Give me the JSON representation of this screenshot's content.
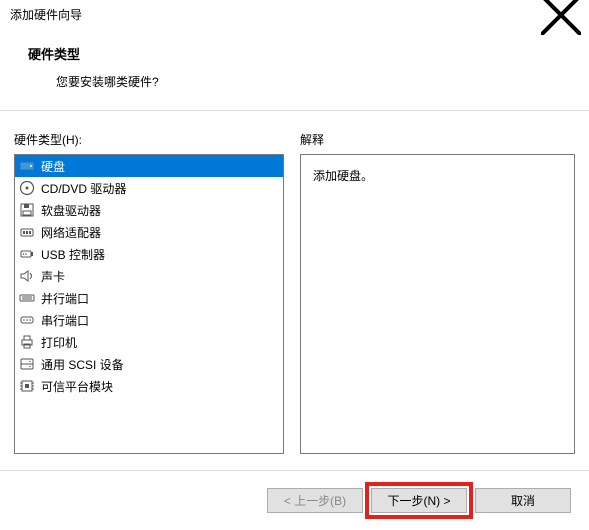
{
  "window": {
    "title": "添加硬件向导"
  },
  "header": {
    "title": "硬件类型",
    "subtitle": "您要安装哪类硬件?"
  },
  "labels": {
    "hardware_types": "硬件类型(H):",
    "explanation": "解释"
  },
  "hardware_list": {
    "items": [
      {
        "icon": "hdd-icon",
        "label": "硬盘",
        "selected": true
      },
      {
        "icon": "cd-icon",
        "label": "CD/DVD 驱动器",
        "selected": false
      },
      {
        "icon": "floppy-icon",
        "label": "软盘驱动器",
        "selected": false
      },
      {
        "icon": "network-icon",
        "label": "网络适配器",
        "selected": false
      },
      {
        "icon": "usb-icon",
        "label": "USB 控制器",
        "selected": false
      },
      {
        "icon": "sound-icon",
        "label": "声卡",
        "selected": false
      },
      {
        "icon": "parallel-icon",
        "label": "并行端口",
        "selected": false
      },
      {
        "icon": "serial-icon",
        "label": "串行端口",
        "selected": false
      },
      {
        "icon": "printer-icon",
        "label": "打印机",
        "selected": false
      },
      {
        "icon": "scsi-icon",
        "label": "通用 SCSI 设备",
        "selected": false
      },
      {
        "icon": "tpm-icon",
        "label": "可信平台模块",
        "selected": false
      }
    ]
  },
  "description": {
    "text": "添加硬盘。"
  },
  "buttons": {
    "back": "< 上一步(B)",
    "next": "下一步(N) >",
    "cancel": "取消"
  }
}
